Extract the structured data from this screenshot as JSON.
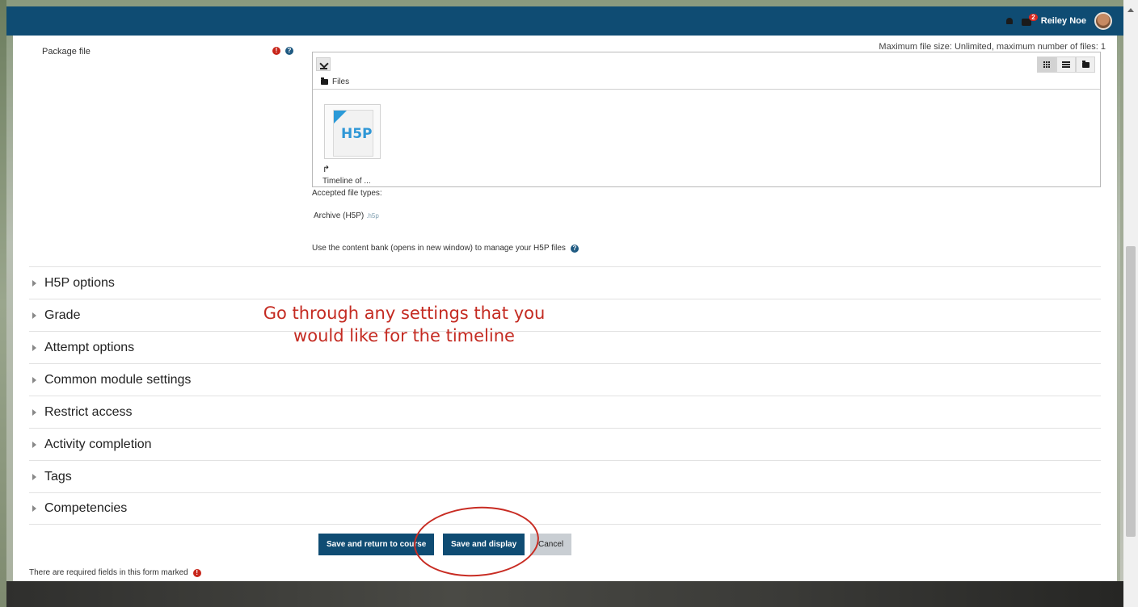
{
  "header": {
    "username": "Reiley Noe",
    "notification_badge": "2"
  },
  "form": {
    "package_label": "Package file",
    "max_size_text": "Maximum file size: Unlimited, maximum number of files: 1",
    "files_breadcrumb": "Files",
    "file_name": "Timeline of ...",
    "file_icon_text": "H5P",
    "accepted_types_label": "Accepted file types:",
    "archive_type": "Archive (H5P)",
    "archive_ext": ".h5p",
    "content_bank_text": "Use the content bank (opens in new window) to manage your H5P files"
  },
  "sections": [
    {
      "label": "H5P options"
    },
    {
      "label": "Grade"
    },
    {
      "label": "Attempt options"
    },
    {
      "label": "Common module settings"
    },
    {
      "label": "Restrict access"
    },
    {
      "label": "Activity completion"
    },
    {
      "label": "Tags"
    },
    {
      "label": "Competencies"
    }
  ],
  "annotation_text": "Go through any settings that you would like for the timeline",
  "buttons": {
    "save_return": "Save and return to course",
    "save_display": "Save and display",
    "cancel": "Cancel"
  },
  "required_note": "There are required fields in this form marked",
  "colors": {
    "navbar": "#0f4c73",
    "primary_button": "#0f4c73",
    "annotation": "#c42b22",
    "required": "#c8261b"
  }
}
